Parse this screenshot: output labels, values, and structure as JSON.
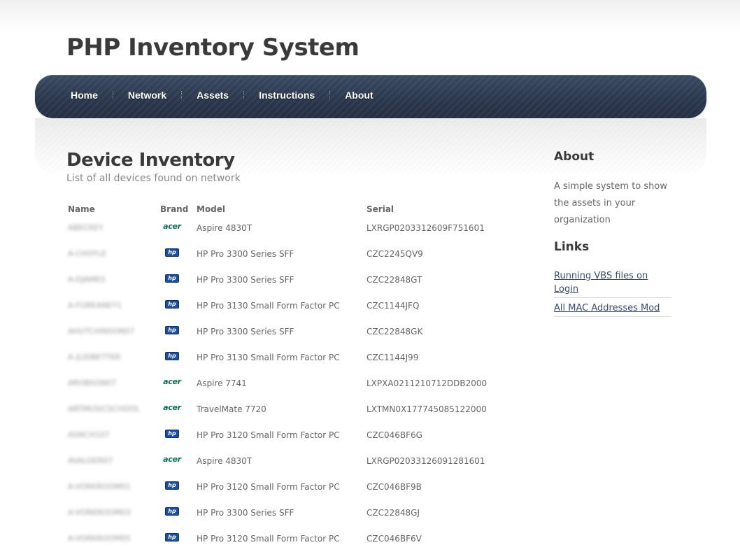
{
  "site": {
    "title": "PHP Inventory System"
  },
  "nav": {
    "items": [
      {
        "label": "Home"
      },
      {
        "label": "Network"
      },
      {
        "label": "Assets"
      },
      {
        "label": "Instructions"
      },
      {
        "label": "About"
      }
    ]
  },
  "main": {
    "title": "Device Inventory",
    "subtitle": "List of all devices found on network",
    "table": {
      "headers": {
        "name": "Name",
        "brand": "Brand",
        "model": "Model",
        "serial": "Serial"
      },
      "rows": [
        {
          "name": "ABECKEY",
          "brand": "acer",
          "model": "Aspire 4830T",
          "serial": "LXRGP0203312609F751601"
        },
        {
          "name": "A-CHOYLE",
          "brand": "hp",
          "model": "HP Pro 3300 Series SFF",
          "serial": "CZC2245QV9"
        },
        {
          "name": "A-DJAMES",
          "brand": "hp",
          "model": "HP Pro 3300 Series SFF",
          "serial": "CZC22848GT"
        },
        {
          "name": "A-FGREANEY1",
          "brand": "hp",
          "model": "HP Pro 3130 Small Form Factor PC",
          "serial": "CZC1144JFQ"
        },
        {
          "name": "AHUTCHINSON07",
          "brand": "hp",
          "model": "HP Pro 3300 Series SFF",
          "serial": "CZC22848GK"
        },
        {
          "name": "A-JLIDBETTER",
          "brand": "hp",
          "model": "HP Pro 3130 Small Form Factor PC",
          "serial": "CZC1144J99"
        },
        {
          "name": "AROBSON07",
          "brand": "acer",
          "model": "Aspire 7741",
          "serial": "LXPXA0211210712DDB2000"
        },
        {
          "name": "ARTMUSICSCHOOL",
          "brand": "acer",
          "model": "TravelMate 7720",
          "serial": "LXTMN0X177745085122000"
        },
        {
          "name": "ASNCH107",
          "brand": "hp",
          "model": "HP Pro 3120 Small Form Factor PC",
          "serial": "CZC046BF6G"
        },
        {
          "name": "AVALDER07",
          "brand": "acer",
          "model": "Aspire 4830T",
          "serial": "LXRGP02033126091281601"
        },
        {
          "name": "A-VORKROOM01",
          "brand": "hp",
          "model": "HP Pro 3120 Small Form Factor PC",
          "serial": "CZC046BF9B"
        },
        {
          "name": "A-VORKROOM03",
          "brand": "hp",
          "model": "HP Pro 3300 Series SFF",
          "serial": "CZC22848GJ"
        },
        {
          "name": "A-VORKROOM05",
          "brand": "hp",
          "model": "HP Pro 3120 Small Form Factor PC",
          "serial": "CZC046BF6V"
        }
      ]
    }
  },
  "sidebar": {
    "about_title": "About",
    "about_text": "A simple system to show the assets in your organization",
    "links_title": "Links",
    "links": [
      {
        "label": "Running VBS files on Login"
      },
      {
        "label": "All MAC Addresses Mod"
      }
    ]
  },
  "brand_logos": {
    "acer": "acer",
    "hp": "hp"
  },
  "colors": {
    "nav_bg": "#2f3c52",
    "acer_green": "#0e6b55",
    "hp_blue": "#1d4f9a",
    "link": "#3a4b6a"
  }
}
